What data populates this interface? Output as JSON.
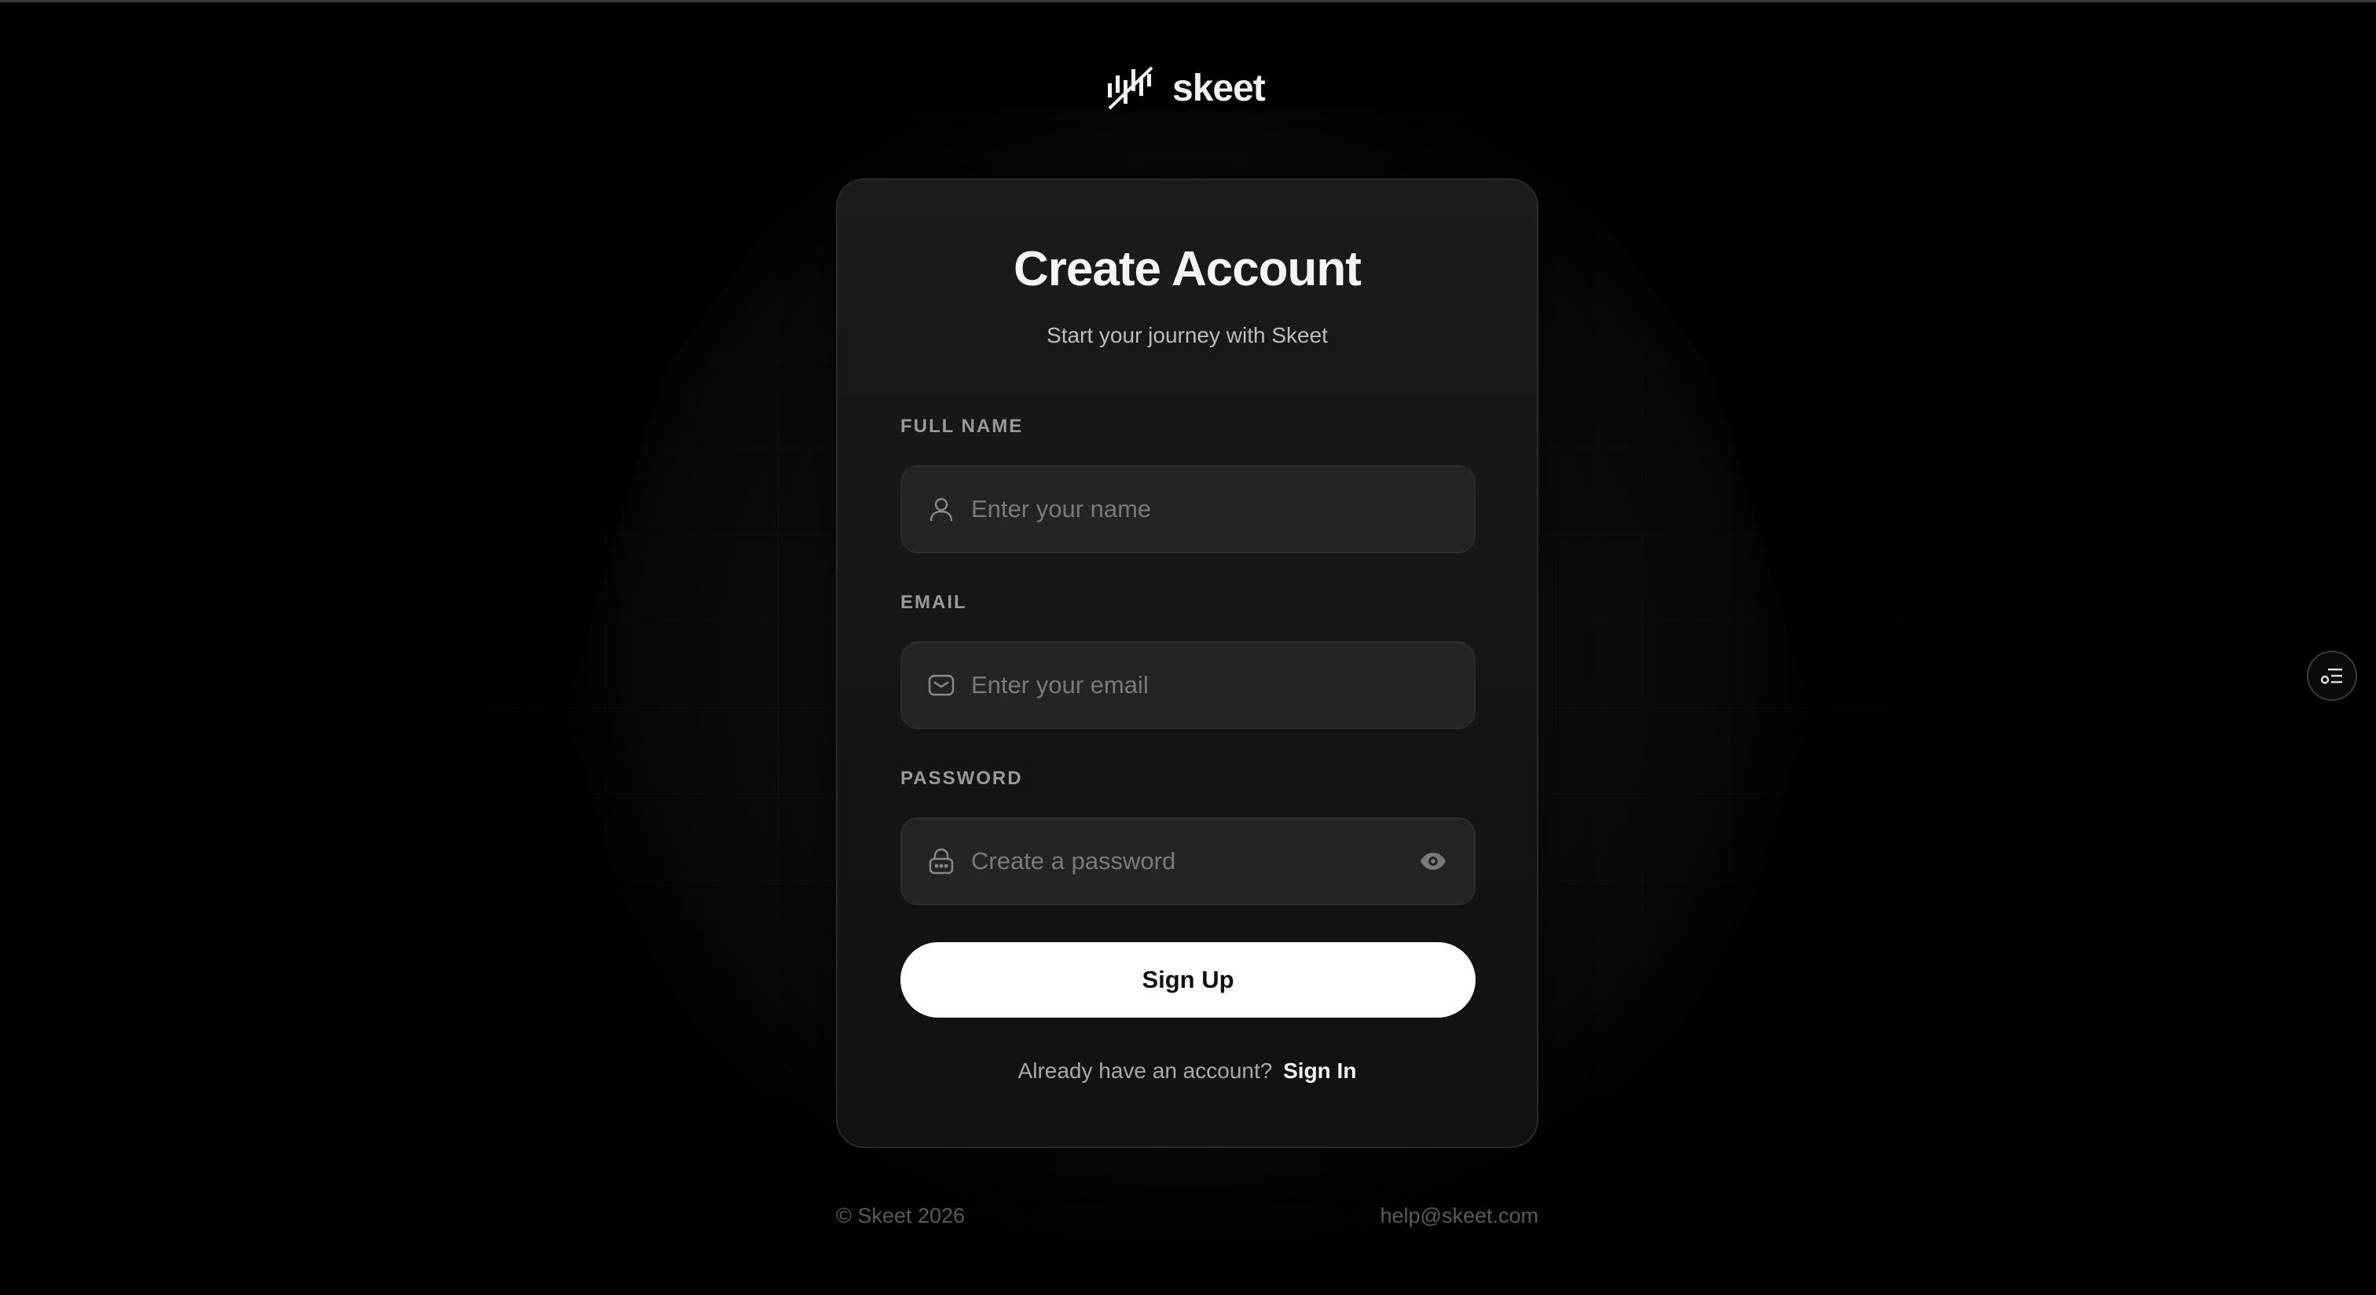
{
  "brand": {
    "name": "skeet",
    "logo_icon": "bars-slash-logo-icon"
  },
  "form": {
    "title": "Create Account",
    "subtitle": "Start your journey with Skeet",
    "fields": [
      {
        "label": "FULL NAME",
        "placeholder": "Enter your name",
        "value": "",
        "icon": "user-icon"
      },
      {
        "label": "EMAIL",
        "placeholder": "Enter your email",
        "value": "",
        "icon": "mail-icon"
      },
      {
        "label": "PASSWORD",
        "placeholder": "Create a password",
        "value": "",
        "icon": "lock-icon",
        "toggle_icon": "eye-icon"
      }
    ],
    "submit_label": "Sign Up",
    "signin_prompt": "Already have an account?",
    "signin_link": "Sign In"
  },
  "footer": {
    "copyright": "© Skeet 2026",
    "email": "help@skeet.com"
  },
  "side_button": {
    "icon": "settings-list-icon"
  },
  "colors": {
    "background": "#000000",
    "card": "#171717",
    "field": "#242424",
    "primary_button": "#ffffff",
    "muted_text": "#5a5a5a"
  }
}
